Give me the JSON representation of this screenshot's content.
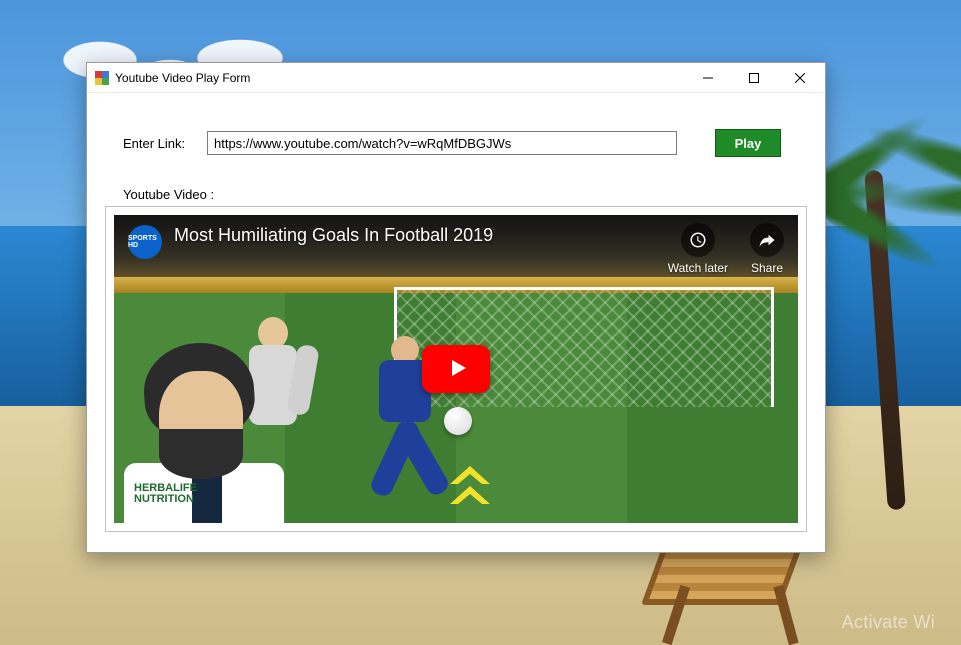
{
  "desktop": {
    "watermark_line1": "Activate Wi"
  },
  "window": {
    "title": "Youtube Video Play Form",
    "form": {
      "link_label": "Enter Link:",
      "link_value": "https://www.youtube.com/watch?v=wRqMfDBGJWs",
      "play_label": "Play",
      "section_label": "Youtube Video :"
    }
  },
  "video": {
    "title": "Most Humiliating Goals In Football 2019",
    "channel_badge_text": "SPORTS HD",
    "watch_later_label": "Watch later",
    "share_label": "Share",
    "jersey_text": "HERBALIFE\nNUTRITION"
  }
}
